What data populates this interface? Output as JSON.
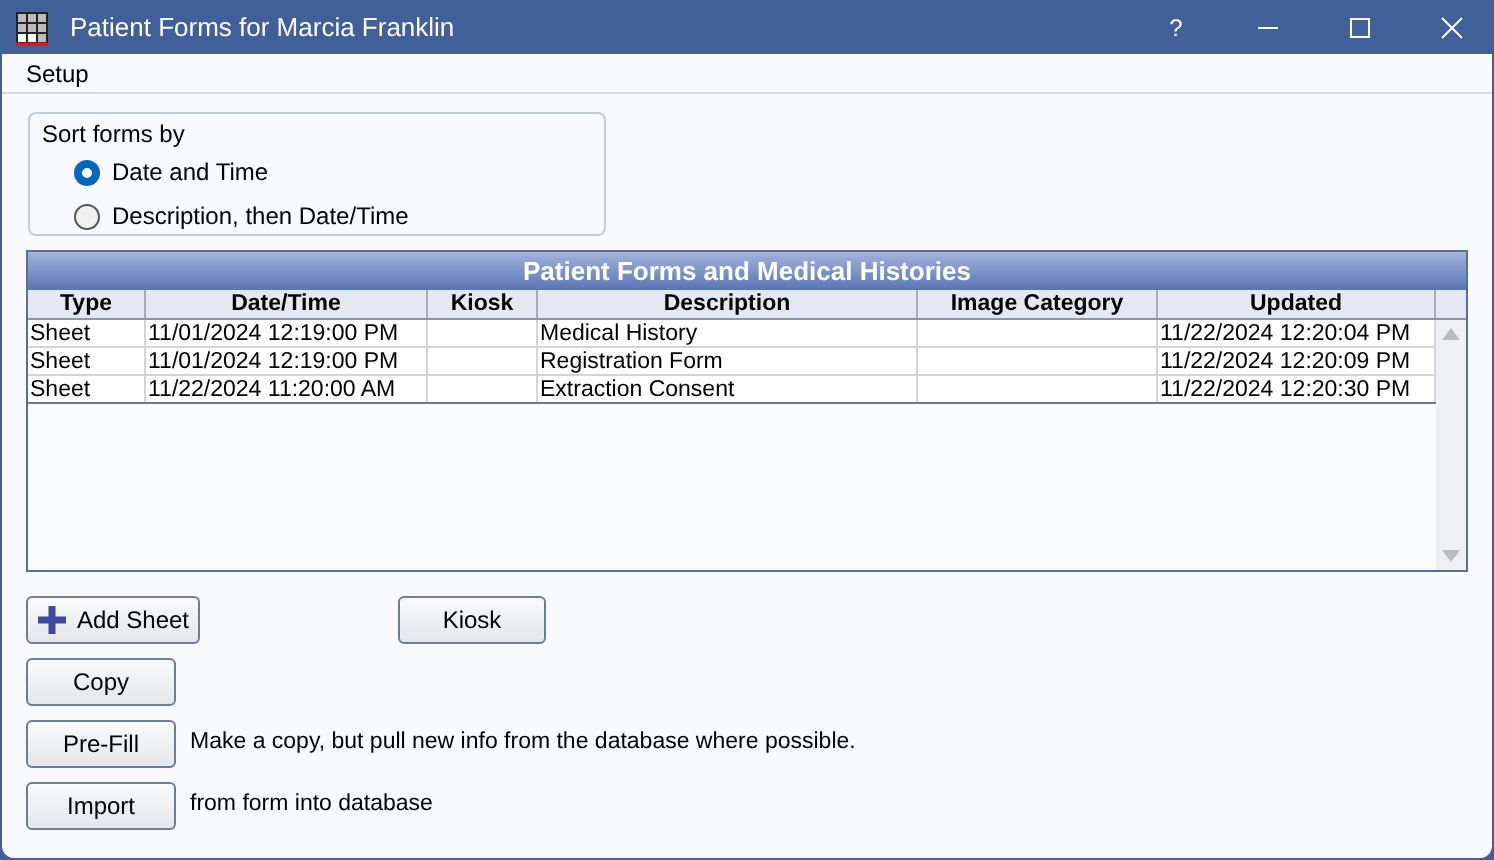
{
  "window": {
    "title": "Patient Forms for Marcia Franklin",
    "controls": [
      "?"
    ]
  },
  "menu": [
    "Setup"
  ],
  "sort": {
    "title": "Sort forms by",
    "options": [
      {
        "label": "Date and Time",
        "selected": true
      },
      {
        "label": "Description, then Date/Time",
        "selected": false
      }
    ]
  },
  "table": {
    "title": "Patient Forms and Medical Histories",
    "columns": [
      "Type",
      "Date/Time",
      "Kiosk",
      "Description",
      "Image Category",
      "Updated"
    ],
    "rows": [
      [
        "Sheet",
        "11/01/2024 12:19:00 PM",
        "",
        "Medical History",
        "",
        "11/22/2024 12:20:04 PM"
      ],
      [
        "Sheet",
        "11/01/2024 12:19:00 PM",
        "",
        "Registration Form",
        "",
        "11/22/2024 12:20:09 PM"
      ],
      [
        "Sheet",
        "11/22/2024 11:20:00 AM",
        "",
        "Extraction Consent",
        "",
        "11/22/2024 12:20:30 PM"
      ]
    ]
  },
  "buttons": {
    "add_sheet": "Add Sheet",
    "kiosk": "Kiosk",
    "copy": "Copy",
    "prefill": "Pre-Fill",
    "prefill_note": "Make a copy, but pull new info from the database where possible.",
    "import": "Import",
    "import_note": "from form into database"
  }
}
